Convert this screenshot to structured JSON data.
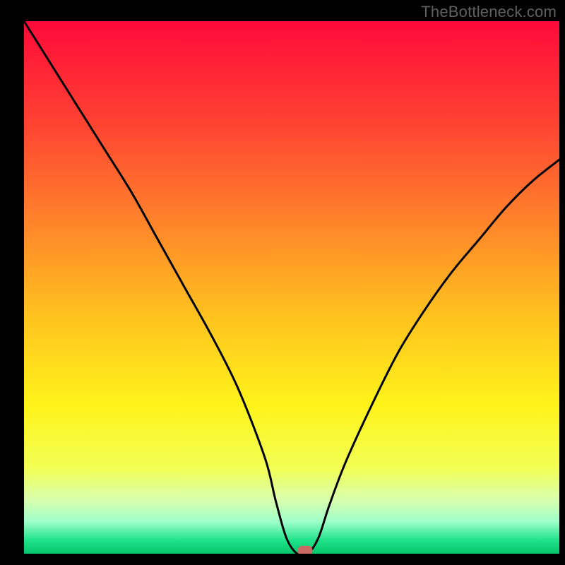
{
  "watermark": "TheBottleneck.com",
  "chart_data": {
    "type": "line",
    "title": "",
    "xlabel": "",
    "ylabel": "",
    "xlim": [
      0,
      100
    ],
    "ylim": [
      0,
      100
    ],
    "grid": false,
    "series": [
      {
        "name": "bottleneck-curve",
        "x": [
          0,
          5,
          10,
          15,
          20,
          25,
          30,
          35,
          40,
          45,
          47,
          49,
          51,
          53,
          55,
          57,
          60,
          65,
          70,
          75,
          80,
          85,
          90,
          95,
          100
        ],
        "y": [
          100,
          92,
          84,
          76,
          68,
          59,
          50,
          41,
          31,
          18,
          10,
          3,
          0,
          0,
          3,
          9,
          17,
          28,
          38,
          46,
          53,
          59,
          65,
          70,
          74
        ]
      }
    ],
    "marker": {
      "x": 52.5,
      "y": 0.5
    },
    "background_gradient": {
      "stops": [
        {
          "offset": 0.0,
          "color": "#ff0a3a"
        },
        {
          "offset": 0.18,
          "color": "#ff3f33"
        },
        {
          "offset": 0.35,
          "color": "#ff7a2c"
        },
        {
          "offset": 0.55,
          "color": "#ffc11f"
        },
        {
          "offset": 0.72,
          "color": "#fff31a"
        },
        {
          "offset": 0.84,
          "color": "#f2ff55"
        },
        {
          "offset": 0.9,
          "color": "#d8ffb0"
        },
        {
          "offset": 0.94,
          "color": "#9effca"
        },
        {
          "offset": 0.975,
          "color": "#1fe28a"
        },
        {
          "offset": 1.0,
          "color": "#04c56a"
        }
      ]
    }
  }
}
